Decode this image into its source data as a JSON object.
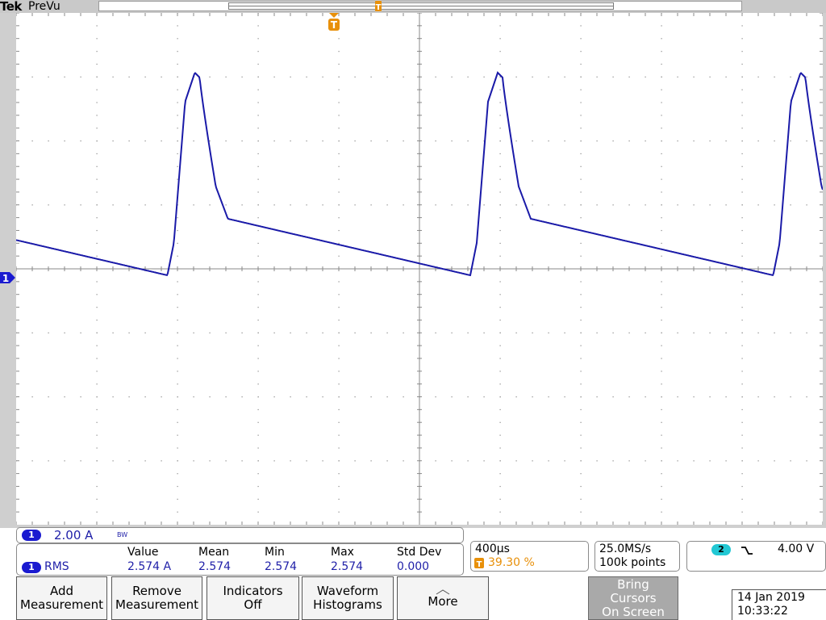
{
  "header": {
    "brand": "Tek",
    "mode": "PreVu"
  },
  "trigger": {
    "marker": "T",
    "position_marker": "T"
  },
  "channel1": {
    "label": "1",
    "scale": "2.00 A",
    "bw_indicator": "BW",
    "color": "#1a1ad0"
  },
  "waveform": {
    "color": "#1a1aa8",
    "description": "sawtooth-like current pulses"
  },
  "measurements": {
    "headers": [
      "Value",
      "Mean",
      "Min",
      "Max",
      "Std Dev"
    ],
    "row": {
      "channel": "1",
      "type": "RMS",
      "value": "2.574 A",
      "mean": "2.574",
      "min": "2.574",
      "max": "2.574",
      "std_dev": "0.000"
    }
  },
  "timebase": {
    "scale": "400µs",
    "trigger_position": "39.30 %"
  },
  "acquisition": {
    "sample_rate": "25.0MS/s",
    "record_length": "100k points"
  },
  "trigger_info": {
    "source": "2",
    "slope_icon": "falling-edge-icon",
    "level": "4.00 V"
  },
  "buttons": {
    "add_measurement": [
      "Add",
      "Measurement"
    ],
    "remove_measurement": [
      "Remove",
      "Measurement"
    ],
    "indicators": [
      "Indicators",
      "Off"
    ],
    "waveform_histograms": [
      "Waveform",
      "Histograms"
    ],
    "more": "More",
    "bring_cursors": [
      "Bring",
      "Cursors",
      "On Screen"
    ]
  },
  "datetime": {
    "date": "14 Jan 2019",
    "time": "10:33:22"
  },
  "colors": {
    "accent_blue": "#1a1ad0",
    "trigger_orange": "#e8900a",
    "trigger_cyan": "#22c8d4"
  }
}
